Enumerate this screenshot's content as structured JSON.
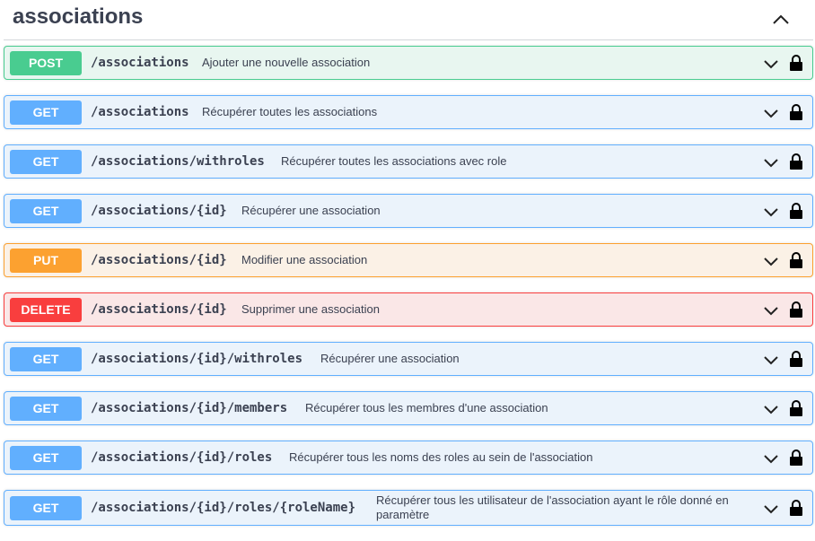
{
  "section": {
    "title": "associations",
    "collapse_icon": "chevron-up-icon"
  },
  "operations": [
    {
      "method": "POST",
      "path": "/associations",
      "summary": "Ajouter une nouvelle association"
    },
    {
      "method": "GET",
      "path": "/associations",
      "summary": "Récupérer toutes les associations"
    },
    {
      "method": "GET",
      "path": "/associations/withroles",
      "summary": "Récupérer toutes les associations avec role"
    },
    {
      "method": "GET",
      "path": "/associations/{id}",
      "summary": "Récupérer une association"
    },
    {
      "method": "PUT",
      "path": "/associations/{id}",
      "summary": "Modifier une association"
    },
    {
      "method": "DELETE",
      "path": "/associations/{id}",
      "summary": "Supprimer une association"
    },
    {
      "method": "GET",
      "path": "/associations/{id}/withroles",
      "summary": "Récupérer une association"
    },
    {
      "method": "GET",
      "path": "/associations/{id}/members",
      "summary": "Récupérer tous les membres d'une association"
    },
    {
      "method": "GET",
      "path": "/associations/{id}/roles",
      "summary": "Récupérer tous les noms des roles au sein de l'association"
    },
    {
      "method": "GET",
      "path": "/associations/{id}/roles/{roleName}",
      "summary": "Récupérer tous les utilisateur de l'association ayant le rôle donné en paramètre"
    }
  ],
  "colors": {
    "post": "#49cc90",
    "get": "#61affe",
    "put": "#fca130",
    "delete": "#f93e3e"
  },
  "icons": {
    "expand": "chevron-down-icon",
    "auth": "lock-icon"
  }
}
